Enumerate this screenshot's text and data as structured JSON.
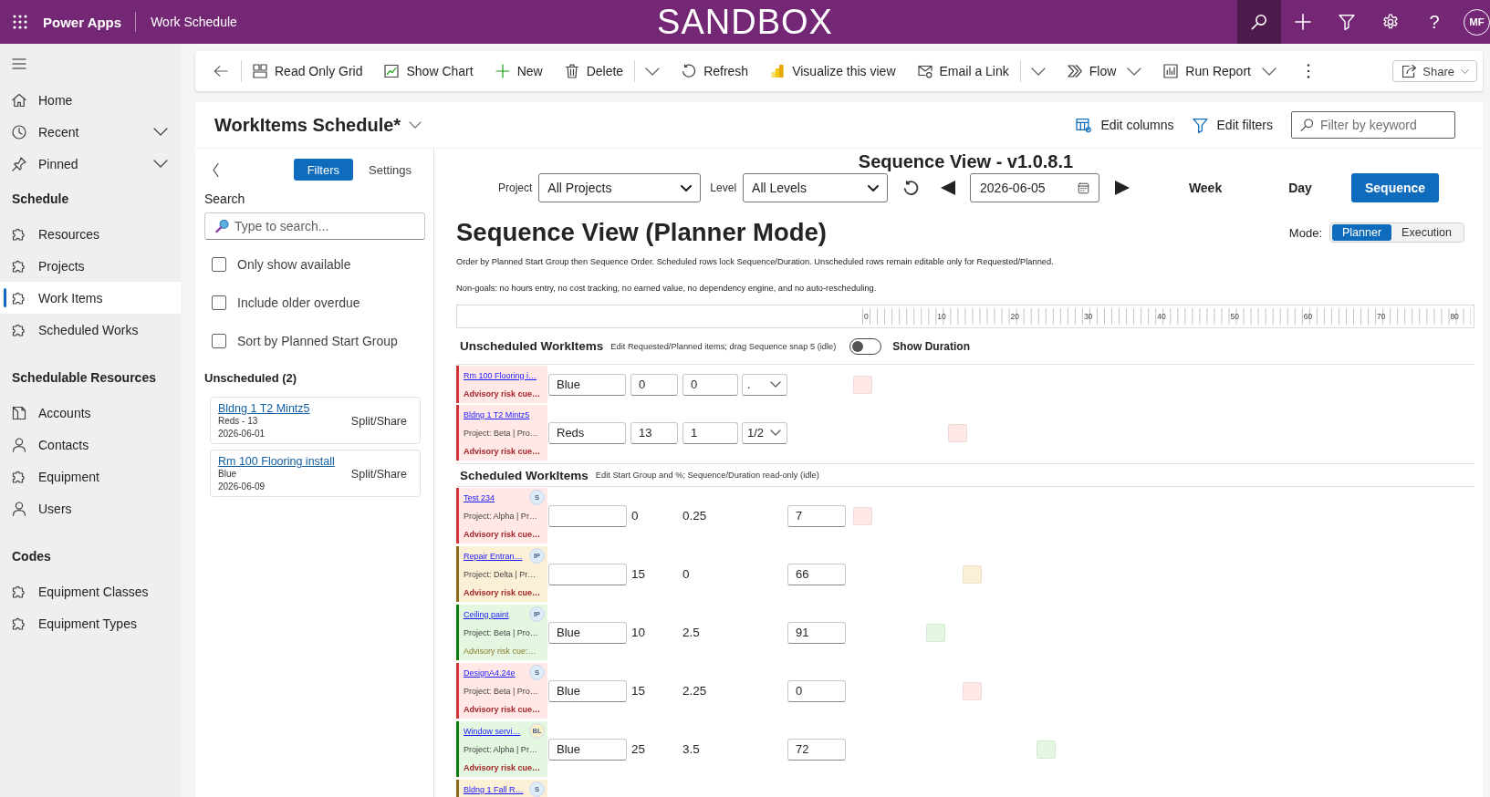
{
  "top_bar": {
    "app_name": "Power Apps",
    "page_title": "Work Schedule",
    "environment": "SANDBOX",
    "help": "?",
    "avatar": "MF"
  },
  "sidebar": {
    "items": [
      {
        "label": "Home",
        "selected": false
      },
      {
        "label": "Recent",
        "selected": false,
        "expanded": false
      },
      {
        "label": "Pinned",
        "selected": false,
        "expanded": false
      }
    ],
    "groups": [
      {
        "heading": "Schedule",
        "items": [
          {
            "label": "Resources",
            "selected": false
          },
          {
            "label": "Projects",
            "selected": false
          },
          {
            "label": "Work Items",
            "selected": true
          },
          {
            "label": "Scheduled Works",
            "selected": false
          }
        ]
      },
      {
        "heading": "Schedulable Resources",
        "items": [
          {
            "label": "Accounts",
            "selected": false
          },
          {
            "label": "Contacts",
            "selected": false
          },
          {
            "label": "Equipment",
            "selected": false
          },
          {
            "label": "Users",
            "selected": false
          }
        ]
      },
      {
        "heading": "Codes",
        "items": [
          {
            "label": "Equipment Classes",
            "selected": false
          },
          {
            "label": "Equipment Types",
            "selected": false
          }
        ]
      }
    ]
  },
  "command_bar": {
    "items": [
      {
        "label": "Read Only Grid",
        "kind": "plain"
      },
      {
        "label": "Show Chart",
        "kind": "plain"
      },
      {
        "label": "New",
        "kind": "plain"
      },
      {
        "label": "Delete",
        "kind": "split"
      },
      {
        "label": "Refresh",
        "kind": "plain"
      },
      {
        "label": "Visualize this view",
        "kind": "plain"
      },
      {
        "label": "Email a Link",
        "kind": "split"
      },
      {
        "label": "Flow",
        "kind": "menu"
      },
      {
        "label": "Run Report",
        "kind": "menu"
      }
    ],
    "share": "Share"
  },
  "view_header": {
    "title": "WorkItems Schedule*",
    "edit_columns": "Edit columns",
    "edit_filters": "Edit filters",
    "keyword_filter": {
      "placeholder": "Filter by keyword"
    }
  },
  "filter_panel": {
    "tabs": [
      {
        "label": "Filters",
        "selected": true
      },
      {
        "label": "Settings",
        "selected": false
      }
    ],
    "search_label": "Search",
    "search": {
      "placeholder": "Type to search..."
    },
    "options": [
      {
        "label": "Only show available",
        "checked": false
      },
      {
        "label": "Include older overdue",
        "checked": false
      },
      {
        "label": "Sort by Planned Start Group",
        "checked": false
      }
    ],
    "unscheduled_heading": "Unscheduled (2)",
    "cards": [
      {
        "title": "Bldng 1 T2 Mintz5",
        "detail": "Reds - 13",
        "date": "2026-06-01",
        "action": "Split/Share"
      },
      {
        "title": "Rm 100 Flooring install",
        "detail": "Blue",
        "date": "2026-06-09",
        "action": "Split/Share"
      }
    ]
  },
  "sequence_view": {
    "version_title": "Sequence View - v1.0.8.1",
    "project_label": "Project",
    "project_select": {
      "value": "All Projects"
    },
    "level_label": "Level",
    "level_select": {
      "value": "All Levels"
    },
    "date": {
      "value": "2026-06-05"
    },
    "view_buttons": [
      {
        "label": "Week",
        "selected": false
      },
      {
        "label": "Day",
        "selected": false
      },
      {
        "label": "Sequence",
        "selected": true
      }
    ],
    "heading": "Sequence View (Planner Mode)",
    "mode_label": "Mode:",
    "modes": [
      {
        "label": "Planner",
        "selected": true
      },
      {
        "label": "Execution",
        "selected": false
      }
    ],
    "notes": [
      "Order by Planned Start Group then Sequence Order. Scheduled rows lock Sequence/Duration. Unscheduled rows remain editable only for Requested/Planned.",
      "Non-goals: no hours entry, no cost tracking, no earned value, no dependency engine, and no auto-rescheduling."
    ],
    "ruler": {
      "labels": [
        "0",
        "10",
        "20",
        "30",
        "40",
        "50",
        "60",
        "70",
        "80"
      ]
    },
    "unscheduled": {
      "title": "Unscheduled WorkItems",
      "hint": "Edit Requested/Planned items; drag Sequence snap 5 (idle)",
      "duration_toggle": {
        "label": "Show Duration",
        "on": false
      },
      "rows": [
        {
          "name": "Rm 100 Flooring i…",
          "color": "#d13438",
          "cue": "Advisory risk cue…",
          "cue_alert": true,
          "start_group": "Blue",
          "sequence": "0",
          "duration": "0",
          "fraction": "."
        },
        {
          "name": "Bldng 1 T2 Mintz5",
          "color": "#d13438",
          "project": "Project: Beta | Pro…",
          "cue": "Advisory risk cue…",
          "cue_alert": true,
          "start_group": "Reds",
          "sequence": "13",
          "duration": "1",
          "fraction": "1/2"
        }
      ]
    },
    "scheduled": {
      "title": "Scheduled WorkItems",
      "hint": "Edit Start Group and %; Sequence/Duration read-only (idle)",
      "rows": [
        {
          "name": "Test 234",
          "badge": {
            "label": "S",
            "color": "#deecf9"
          },
          "color": "#d13438",
          "project": "Project: Alpha | Pr…",
          "cue": "Advisory risk cue…",
          "cue_alert": true,
          "sequence": "0",
          "duration": "0.25",
          "percent": "7"
        },
        {
          "name": "Repair Entran…",
          "badge": {
            "label": "IP",
            "color": "#deecf9"
          },
          "color": "#8c6d1f",
          "project": "Project: Delta | Pr…",
          "cue": "Advisory risk cue…",
          "cue_alert": true,
          "sequence": "15",
          "duration": "0",
          "percent": "66"
        },
        {
          "name": "Ceiling paint",
          "badge": {
            "label": "IP",
            "color": "#deecf9"
          },
          "color": "#107c10",
          "project": "Project: Beta | Pro…",
          "cue": "Advisory risk cue:…",
          "cue_alert": false,
          "start_group": "Blue",
          "sequence": "10",
          "duration": "2.5",
          "percent": "91"
        },
        {
          "name": "DesignA4.24e",
          "badge": {
            "label": "S",
            "color": "#deecf9"
          },
          "color": "#d13438",
          "project": "Project: Beta | Pro…",
          "cue": "Advisory risk cue…",
          "cue_alert": true,
          "start_group": "Blue",
          "sequence": "15",
          "duration": "2.25",
          "percent": "0"
        },
        {
          "name": "Window servi…",
          "badge": {
            "label": "BL",
            "color": "#fbefcd"
          },
          "color": "#107c10",
          "project": "Project: Alpha | Pr…",
          "cue": "Advisory risk cue…",
          "cue_alert": true,
          "start_group": "Blue",
          "sequence": "25",
          "duration": "3.5",
          "percent": "72"
        },
        {
          "name": "Bldng 1 Fall R…",
          "badge": {
            "label": "S",
            "color": "#deecf9"
          },
          "color": "#8c6d1f"
        }
      ]
    }
  }
}
